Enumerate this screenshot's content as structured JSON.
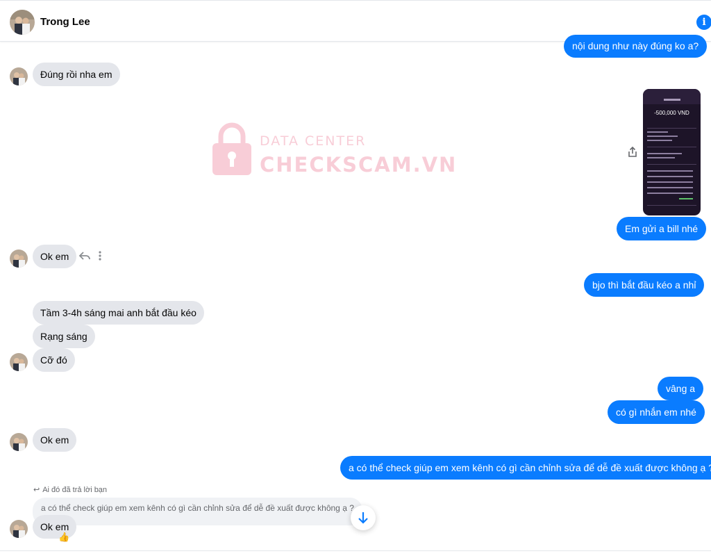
{
  "header": {
    "contact_name": "Trong Lee",
    "info_icon": "info-icon"
  },
  "watermark": {
    "line1": "DATA CENTER",
    "line2": "CHECKSCAM.VN"
  },
  "messages": {
    "m1": "nội dung như này đúng ko a?",
    "m2": "Đúng rồi nha em",
    "m3": "Em gửi a bill nhé",
    "m4": "Ok em",
    "m5": "bjo thì bắt đầu kéo a nhỉ",
    "m6": "Tầm 3-4h sáng mai anh bắt đầu kéo",
    "m7": "Rạng sáng",
    "m8": "Cỡ đó",
    "m9": "vâng a",
    "m10": "có gì nhắn em nhé",
    "m11": "Ok em",
    "m12": "a có thể check giúp em xem kênh có gì cần chỉnh sửa để dễ đề xuất được không ạ ?",
    "m13": "Ok em"
  },
  "reply": {
    "note": "Ai đó đã trả lời bạn",
    "quoted": "a có thể check giúp em xem kênh có gì cần chỉnh sửa để dễ đề xuất được không ạ ?"
  },
  "receipt": {
    "amount": "-500,000 VND"
  },
  "reaction": "👍",
  "colors": {
    "outgoing": "#0a7cff",
    "incoming": "#e4e6eb",
    "watermark": "#f4a6b8"
  }
}
